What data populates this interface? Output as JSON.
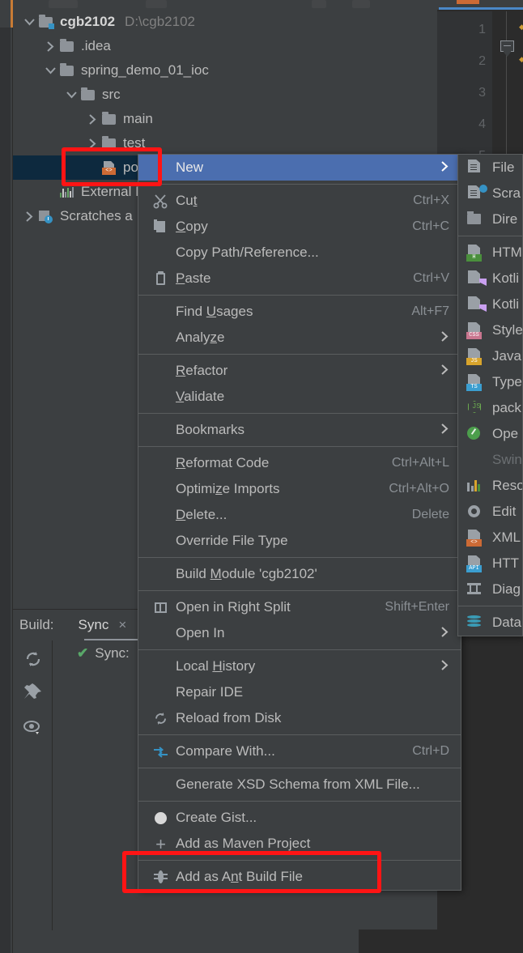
{
  "app": {
    "theme_bg": "#3c3f41",
    "accent": "#4b6eaf",
    "annotation_color": "#ff1414"
  },
  "project_tree": {
    "items": [
      {
        "label": "cgb2102",
        "path": "D:\\cgb2102",
        "icon": "module-folder-icon",
        "arrow": "chevron-down",
        "indent": 0,
        "bold": true,
        "selected": false
      },
      {
        "label": ".idea",
        "path": "",
        "icon": "folder-icon",
        "arrow": "chevron-right",
        "indent": 1,
        "bold": false,
        "selected": false
      },
      {
        "label": "spring_demo_01_ioc",
        "path": "",
        "icon": "folder-icon",
        "arrow": "chevron-down",
        "indent": 1,
        "bold": false,
        "selected": false
      },
      {
        "label": "src",
        "path": "",
        "icon": "folder-icon",
        "arrow": "chevron-down",
        "indent": 2,
        "bold": false,
        "selected": false
      },
      {
        "label": "main",
        "path": "",
        "icon": "folder-icon",
        "arrow": "chevron-right",
        "indent": 3,
        "bold": false,
        "selected": false
      },
      {
        "label": "test",
        "path": "",
        "icon": "folder-icon",
        "arrow": "chevron-right",
        "indent": 3,
        "bold": false,
        "selected": false
      },
      {
        "label": "pom.",
        "path": "",
        "icon": "xml-file-icon",
        "arrow": "none",
        "indent": 3,
        "bold": false,
        "selected": true
      },
      {
        "label": "External Lib",
        "path": "",
        "icon": "library-icon",
        "arrow": "none",
        "indent": 1,
        "bold": false,
        "selected": false
      },
      {
        "label": "Scratches a",
        "path": "",
        "icon": "scratches-icon",
        "arrow": "chevron-right",
        "indent": 0,
        "bold": false,
        "selected": false
      }
    ]
  },
  "editor": {
    "line_numbers": [
      "1",
      "2",
      "3",
      "4",
      "5"
    ],
    "fold_marker": "collapsed-region-marker"
  },
  "build_panel": {
    "title": "Build:",
    "tab": "Sync",
    "close_label": "×",
    "status_text": "Sync: ",
    "status_icon": "green-check-icon",
    "side_buttons": [
      "rerun-icon",
      "pin-icon",
      "eye-icon"
    ]
  },
  "context_menu": {
    "items": [
      {
        "kind": "item",
        "label": "New",
        "mnemonic": "",
        "shortcut": "",
        "submenu": true,
        "icon": "",
        "highlighted": true,
        "disabled": false
      },
      {
        "kind": "sep"
      },
      {
        "kind": "item",
        "label": "Cut",
        "mnemonic": "t",
        "shortcut": "Ctrl+X",
        "submenu": false,
        "icon": "scissors-icon",
        "highlighted": false,
        "disabled": false
      },
      {
        "kind": "item",
        "label": "Copy",
        "mnemonic": "C",
        "shortcut": "Ctrl+C",
        "submenu": false,
        "icon": "copy-icon",
        "highlighted": false,
        "disabled": false
      },
      {
        "kind": "item",
        "label": "Copy Path/Reference...",
        "mnemonic": "",
        "shortcut": "",
        "submenu": false,
        "icon": "",
        "highlighted": false,
        "disabled": false
      },
      {
        "kind": "item",
        "label": "Paste",
        "mnemonic": "P",
        "shortcut": "Ctrl+V",
        "submenu": false,
        "icon": "paste-icon",
        "highlighted": false,
        "disabled": false
      },
      {
        "kind": "sep"
      },
      {
        "kind": "item",
        "label": "Find Usages",
        "mnemonic": "U",
        "shortcut": "Alt+F7",
        "submenu": false,
        "icon": "",
        "highlighted": false,
        "disabled": false
      },
      {
        "kind": "item",
        "label": "Analyze",
        "mnemonic": "z",
        "shortcut": "",
        "submenu": true,
        "icon": "",
        "highlighted": false,
        "disabled": false
      },
      {
        "kind": "sep"
      },
      {
        "kind": "item",
        "label": "Refactor",
        "mnemonic": "R",
        "shortcut": "",
        "submenu": true,
        "icon": "",
        "highlighted": false,
        "disabled": false
      },
      {
        "kind": "item",
        "label": "Validate",
        "mnemonic": "V",
        "shortcut": "",
        "submenu": false,
        "icon": "",
        "highlighted": false,
        "disabled": false
      },
      {
        "kind": "sep"
      },
      {
        "kind": "item",
        "label": "Bookmarks",
        "mnemonic": "",
        "shortcut": "",
        "submenu": true,
        "icon": "",
        "highlighted": false,
        "disabled": false
      },
      {
        "kind": "sep"
      },
      {
        "kind": "item",
        "label": "Reformat Code",
        "mnemonic": "R",
        "shortcut": "Ctrl+Alt+L",
        "submenu": false,
        "icon": "",
        "highlighted": false,
        "disabled": false
      },
      {
        "kind": "item",
        "label": "Optimize Imports",
        "mnemonic": "z",
        "shortcut": "Ctrl+Alt+O",
        "submenu": false,
        "icon": "",
        "highlighted": false,
        "disabled": false
      },
      {
        "kind": "item",
        "label": "Delete...",
        "mnemonic": "D",
        "shortcut": "Delete",
        "submenu": false,
        "icon": "",
        "highlighted": false,
        "disabled": false
      },
      {
        "kind": "item",
        "label": "Override File Type",
        "mnemonic": "",
        "shortcut": "",
        "submenu": false,
        "icon": "",
        "highlighted": false,
        "disabled": false
      },
      {
        "kind": "sep"
      },
      {
        "kind": "item",
        "label": "Build Module 'cgb2102'",
        "mnemonic": "M",
        "shortcut": "",
        "submenu": false,
        "icon": "",
        "highlighted": false,
        "disabled": false
      },
      {
        "kind": "sep"
      },
      {
        "kind": "item",
        "label": "Open in Right Split",
        "mnemonic": "",
        "shortcut": "Shift+Enter",
        "submenu": false,
        "icon": "split-icon",
        "highlighted": false,
        "disabled": false
      },
      {
        "kind": "item",
        "label": "Open In",
        "mnemonic": "",
        "shortcut": "",
        "submenu": true,
        "icon": "",
        "highlighted": false,
        "disabled": false
      },
      {
        "kind": "sep"
      },
      {
        "kind": "item",
        "label": "Local History",
        "mnemonic": "H",
        "shortcut": "",
        "submenu": true,
        "icon": "",
        "highlighted": false,
        "disabled": false
      },
      {
        "kind": "item",
        "label": "Repair IDE",
        "mnemonic": "",
        "shortcut": "",
        "submenu": false,
        "icon": "",
        "highlighted": false,
        "disabled": false
      },
      {
        "kind": "item",
        "label": "Reload from Disk",
        "mnemonic": "",
        "shortcut": "",
        "submenu": false,
        "icon": "reload-icon",
        "highlighted": false,
        "disabled": false
      },
      {
        "kind": "sep"
      },
      {
        "kind": "item",
        "label": "Compare With...",
        "mnemonic": "",
        "shortcut": "Ctrl+D",
        "submenu": false,
        "icon": "compare-icon",
        "highlighted": false,
        "disabled": false
      },
      {
        "kind": "sep"
      },
      {
        "kind": "item",
        "label": "Generate XSD Schema from XML File...",
        "mnemonic": "",
        "shortcut": "",
        "submenu": false,
        "icon": "",
        "highlighted": false,
        "disabled": false
      },
      {
        "kind": "sep"
      },
      {
        "kind": "item",
        "label": "Create Gist...",
        "mnemonic": "",
        "shortcut": "",
        "submenu": false,
        "icon": "gist-icon",
        "highlighted": false,
        "disabled": false
      },
      {
        "kind": "item",
        "label": "Add as Maven Project",
        "mnemonic": "",
        "shortcut": "",
        "submenu": false,
        "icon": "plus-icon",
        "highlighted": false,
        "disabled": false
      },
      {
        "kind": "sep"
      },
      {
        "kind": "item",
        "label": "Add as Ant Build File",
        "mnemonic": "n",
        "shortcut": "",
        "submenu": false,
        "icon": "ant-icon",
        "highlighted": false,
        "disabled": false
      }
    ]
  },
  "new_submenu": {
    "items": [
      {
        "kind": "item",
        "label": "File",
        "icon": "file-icon",
        "disabled": false
      },
      {
        "kind": "item",
        "label": "Scra",
        "icon": "scratch-file-icon",
        "disabled": false
      },
      {
        "kind": "item",
        "label": "Dire",
        "icon": "directory-icon",
        "disabled": false
      },
      {
        "kind": "sep"
      },
      {
        "kind": "item",
        "label": "HTM",
        "icon": "html-file-icon",
        "disabled": false
      },
      {
        "kind": "item",
        "label": "Kotli",
        "icon": "kotlin-file-icon",
        "disabled": false
      },
      {
        "kind": "item",
        "label": "Kotli",
        "icon": "kotlin-script-icon",
        "disabled": false
      },
      {
        "kind": "item",
        "label": "Style",
        "icon": "css-file-icon",
        "disabled": false
      },
      {
        "kind": "item",
        "label": "Java",
        "icon": "javascript-file-icon",
        "disabled": false
      },
      {
        "kind": "item",
        "label": "Type",
        "icon": "typescript-file-icon",
        "disabled": false
      },
      {
        "kind": "item",
        "label": "pack",
        "icon": "nodejs-package-icon",
        "disabled": false
      },
      {
        "kind": "item",
        "label": "Ope",
        "icon": "openapi-icon",
        "disabled": false
      },
      {
        "kind": "item",
        "label": "Swin",
        "icon": "",
        "disabled": true
      },
      {
        "kind": "item",
        "label": "Reso",
        "icon": "resource-bundle-icon",
        "disabled": false
      },
      {
        "kind": "item",
        "label": "Edit",
        "icon": "editorconfig-icon",
        "disabled": false
      },
      {
        "kind": "item",
        "label": "XML",
        "icon": "xml-file-icon",
        "disabled": false
      },
      {
        "kind": "item",
        "label": "HTT",
        "icon": "http-request-icon",
        "disabled": false
      },
      {
        "kind": "item",
        "label": "Diag",
        "icon": "diagram-icon",
        "disabled": false
      },
      {
        "kind": "sep"
      },
      {
        "kind": "item",
        "label": "Data",
        "icon": "datasource-icon",
        "disabled": false
      }
    ]
  },
  "annotations": [
    {
      "name": "pom-file-highlight",
      "shape": "rect"
    },
    {
      "name": "add-as-maven-project-highlight",
      "shape": "rect"
    }
  ]
}
